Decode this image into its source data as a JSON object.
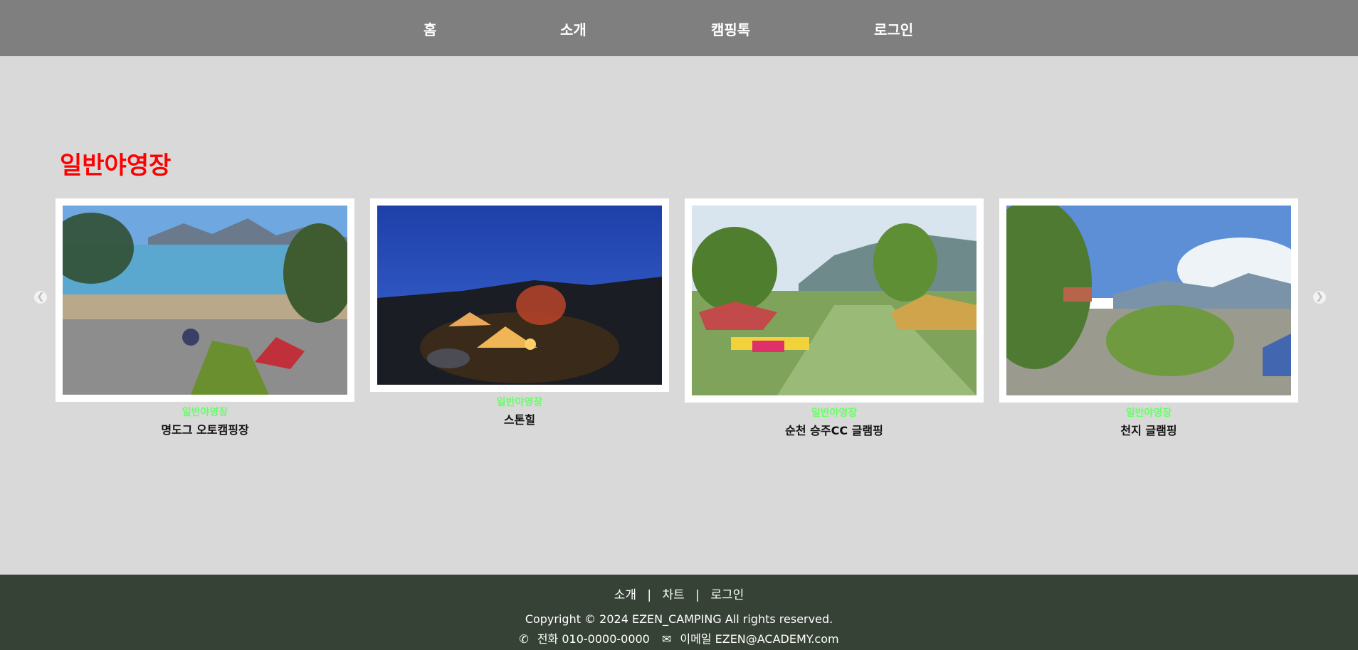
{
  "nav": {
    "home": "홈",
    "about": "소개",
    "campingtalk": "캠핑톡",
    "login": "로그인"
  },
  "section": {
    "title": "일반야영장"
  },
  "cards": [
    {
      "category": "일반야영장",
      "name": "명도그 오토캠핑장"
    },
    {
      "category": "일반야영장",
      "name": "스톤힐"
    },
    {
      "category": "일반야영장",
      "name": "순천 승주CC 글램핑"
    },
    {
      "category": "일반야영장",
      "name": "천지 글램핑"
    }
  ],
  "carousel": {
    "prev_icon": "chevron-left-icon",
    "next_icon": "chevron-right-icon"
  },
  "footer": {
    "links": [
      "소개",
      "차트",
      "로그인"
    ],
    "separator": "|",
    "copyright": "Copyright © 2024 EZEN_CAMPING All rights reserved.",
    "phone": "전화 010-0000-0000",
    "email": "이메일 EZEN@ACADEMY.com"
  },
  "colors": {
    "nav_bg": "#7f7f7f",
    "page_bg": "#d9d9d9",
    "title": "#ff0000",
    "category": "#66ff66",
    "footer_bg": "#374237"
  }
}
